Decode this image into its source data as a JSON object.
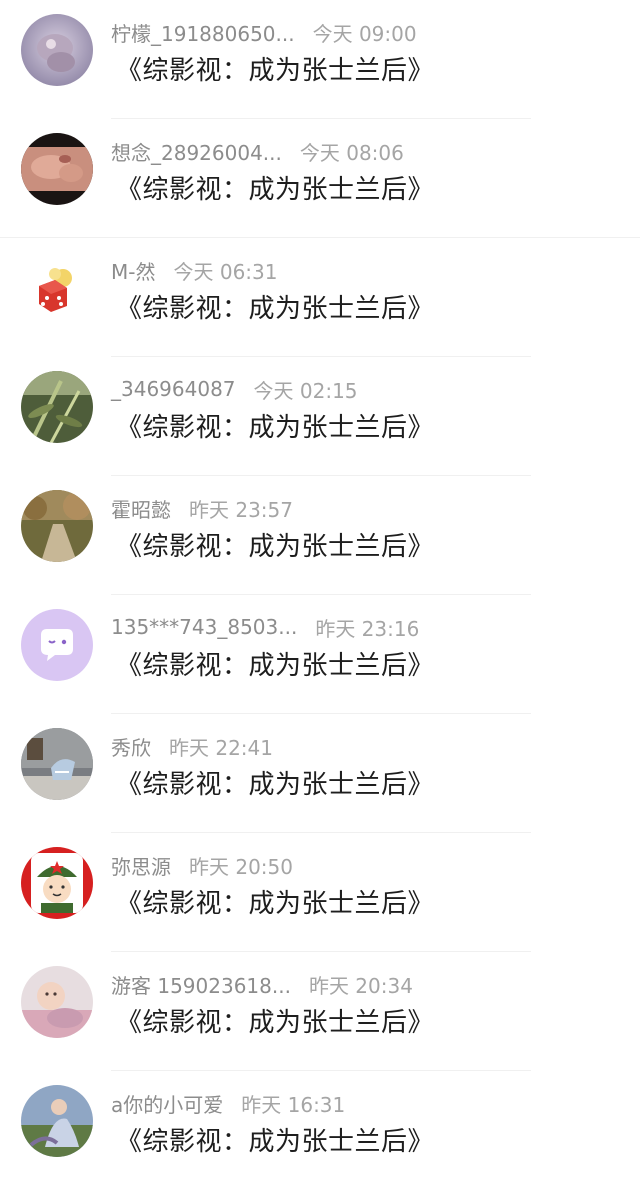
{
  "comments": [
    {
      "name": "柠檬_191880650...",
      "time": "今天 09:00",
      "title": "《综影视：成为张士兰后》",
      "avatar": "baby-photo"
    },
    {
      "name": "想念_28926004...",
      "time": "今天 08:06",
      "title": "《综影视：成为张士兰后》",
      "avatar": "hands-photo"
    },
    {
      "name": "M-然",
      "time": "今天 06:31",
      "title": "《综影视：成为张士兰后》",
      "avatar": "dice-sticker"
    },
    {
      "name": "_346964087",
      "time": "今天 02:15",
      "title": "《综影视：成为张士兰后》",
      "avatar": "bamboo-photo"
    },
    {
      "name": "霍昭懿",
      "time": "昨天 23:57",
      "title": "《综影视：成为张士兰后》",
      "avatar": "garden-path-photo"
    },
    {
      "name": "135***743_8503...",
      "time": "昨天 23:16",
      "title": "《综影视：成为张士兰后》",
      "avatar": "default-chat-avatar"
    },
    {
      "name": "秀欣",
      "time": "昨天 22:41",
      "title": "《综影视：成为张士兰后》",
      "avatar": "room-chair-photo"
    },
    {
      "name": "弥思源",
      "time": "昨天 20:50",
      "title": "《综影视：成为张士兰后》",
      "avatar": "cartoon-soldier"
    },
    {
      "name": "游客 159023618...",
      "time": "昨天 20:34",
      "title": "《综影视：成为张士兰后》",
      "avatar": "child-photo"
    },
    {
      "name": "a你的小可爱",
      "time": "昨天 16:31",
      "title": "《综影视：成为张士兰后》",
      "avatar": "outdoor-person-photo"
    }
  ]
}
